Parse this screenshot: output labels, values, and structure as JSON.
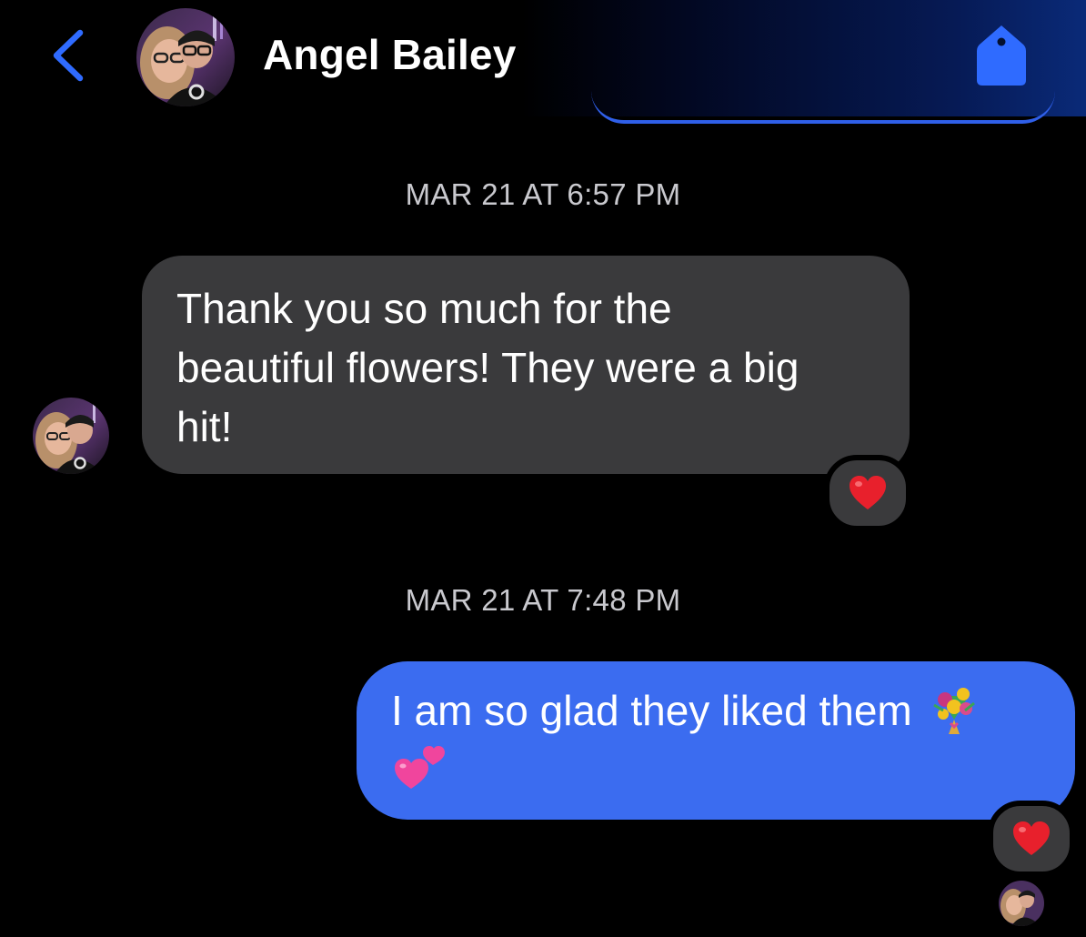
{
  "header": {
    "contact_name": "Angel Bailey",
    "back_icon": "chevron-left-icon",
    "tag_icon": "tag-icon",
    "accent_color": "#2f6bff"
  },
  "messages": [
    {
      "timestamp": "MAR 21 AT 6:57 PM",
      "direction": "incoming",
      "text": "Thank you so much for the beautiful flowers! They were a big hit!",
      "lines": [
        "Thank you so much for the",
        "beautiful flowers! They were a big",
        "hit!"
      ],
      "reaction": "red-heart",
      "bubble_color": "#3a3a3c"
    },
    {
      "timestamp": "MAR 21 AT 7:48 PM",
      "direction": "outgoing",
      "text": "I am so glad they liked them",
      "emojis": [
        "bouquet",
        "two-hearts"
      ],
      "reaction": "red-heart",
      "bubble_color": "#3b6cf0"
    }
  ]
}
